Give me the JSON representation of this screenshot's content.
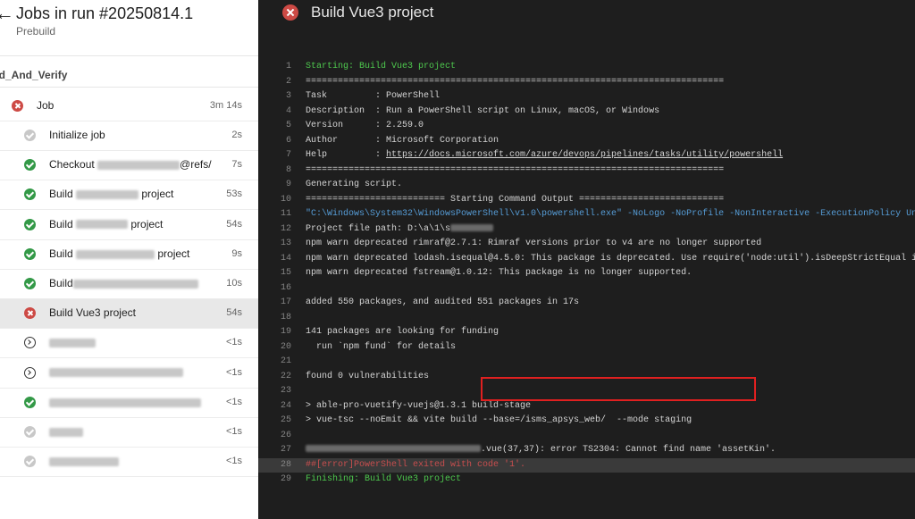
{
  "left": {
    "title": "Jobs in run #20250814.1",
    "subtitle": "Prebuild",
    "stage": "ild_And_Verify",
    "job": {
      "label": "Job",
      "duration": "3m 14s",
      "status": "fail"
    },
    "steps": [
      {
        "pre": "Initialize job",
        "post": "",
        "blur": 0,
        "duration": "2s",
        "status": "skip"
      },
      {
        "pre": "Checkout ",
        "post": "@refs/",
        "blur": 92,
        "duration": "7s",
        "status": "ok"
      },
      {
        "pre": "Build ",
        "post": " project",
        "blur": 70,
        "duration": "53s",
        "status": "ok"
      },
      {
        "pre": "Build ",
        "post": " project",
        "blur": 58,
        "duration": "54s",
        "status": "ok"
      },
      {
        "pre": "Build ",
        "post": " project",
        "blur": 88,
        "duration": "9s",
        "status": "ok"
      },
      {
        "pre": "Build",
        "post": "",
        "blur": 140,
        "duration": "10s",
        "status": "ok"
      },
      {
        "pre": "Build Vue3 project",
        "post": "",
        "blur": 0,
        "duration": "54s",
        "status": "fail",
        "selected": true
      },
      {
        "pre": "",
        "post": "",
        "blur": 52,
        "duration": "<1s",
        "status": "pend"
      },
      {
        "pre": "",
        "post": "",
        "blur": 150,
        "duration": "<1s",
        "status": "pend"
      },
      {
        "pre": "",
        "post": "",
        "blur": 170,
        "duration": "<1s",
        "status": "ok"
      },
      {
        "pre": "",
        "post": "",
        "blur": 38,
        "duration": "<1s",
        "status": "skip"
      },
      {
        "pre": "",
        "post": "",
        "blur": 78,
        "duration": "<1s",
        "status": "skip"
      }
    ]
  },
  "right": {
    "title": "Build Vue3 project",
    "lines": [
      {
        "n": "1",
        "segs": [
          {
            "t": "Starting: Build Vue3 project",
            "c": "green"
          }
        ]
      },
      {
        "n": "2",
        "segs": [
          {
            "t": "=============================================================================="
          }
        ]
      },
      {
        "n": "3",
        "segs": [
          {
            "t": "Task         : PowerShell"
          }
        ]
      },
      {
        "n": "4",
        "segs": [
          {
            "t": "Description  : Run a PowerShell script on Linux, macOS, or Windows"
          }
        ]
      },
      {
        "n": "5",
        "segs": [
          {
            "t": "Version      : 2.259.0"
          }
        ]
      },
      {
        "n": "6",
        "segs": [
          {
            "t": "Author       : Microsoft Corporation"
          }
        ]
      },
      {
        "n": "7",
        "segs": [
          {
            "t": "Help         : "
          },
          {
            "t": "https://docs.microsoft.com/azure/devops/pipelines/tasks/utility/powershell",
            "link": true
          }
        ]
      },
      {
        "n": "8",
        "segs": [
          {
            "t": "=============================================================================="
          }
        ]
      },
      {
        "n": "9",
        "segs": [
          {
            "t": "Generating script."
          }
        ]
      },
      {
        "n": "10",
        "segs": [
          {
            "t": "========================== Starting Command Output ==========================="
          }
        ]
      },
      {
        "n": "11",
        "segs": [
          {
            "t": "\"C:\\Windows\\System32\\WindowsPowerShell\\v1.0\\powershell.exe\" -NoLogo -NoProfile -NonInteractive -ExecutionPolicy Unrestricted",
            "c": "blue"
          }
        ]
      },
      {
        "n": "12",
        "segs": [
          {
            "t": "Project file path: D:\\a\\1\\s"
          },
          {
            "blur": 48
          }
        ]
      },
      {
        "n": "13",
        "segs": [
          {
            "t": "npm warn deprecated rimraf@2.7.1: Rimraf versions prior to v4 are no longer supported"
          }
        ]
      },
      {
        "n": "14",
        "segs": [
          {
            "t": "npm warn deprecated lodash.isequal@4.5.0: This package is deprecated. Use require('node:util').isDeepStrictEqual instead."
          }
        ]
      },
      {
        "n": "15",
        "segs": [
          {
            "t": "npm warn deprecated fstream@1.0.12: This package is no longer supported."
          }
        ]
      },
      {
        "n": "16",
        "segs": []
      },
      {
        "n": "17",
        "segs": [
          {
            "t": "added 550 packages, and audited 551 packages in 17s"
          }
        ]
      },
      {
        "n": "18",
        "segs": []
      },
      {
        "n": "19",
        "segs": [
          {
            "t": "141 packages are looking for funding"
          }
        ]
      },
      {
        "n": "20",
        "segs": [
          {
            "t": "  run `npm fund` for details"
          }
        ]
      },
      {
        "n": "21",
        "segs": []
      },
      {
        "n": "22",
        "segs": [
          {
            "t": "found 0 vulnerabilities"
          }
        ]
      },
      {
        "n": "23",
        "segs": []
      },
      {
        "n": "24",
        "segs": [
          {
            "t": "> able-pro-vuetify-vuejs@1.3.1 build-stage"
          }
        ]
      },
      {
        "n": "25",
        "segs": [
          {
            "t": "> vue-tsc --noEmit && vite build --base=/isms_apsys_web/  --mode staging"
          }
        ]
      },
      {
        "n": "26",
        "segs": []
      },
      {
        "n": "27",
        "segs": [
          {
            "blur": 196
          },
          {
            "t": ".vue(37,37): error TS2304: Cannot find name 'assetKin'."
          }
        ]
      },
      {
        "n": "28",
        "err": true,
        "segs": [
          {
            "t": "##[error]PowerShell exited with code '1'.",
            "c": "red"
          }
        ]
      },
      {
        "n": "29",
        "segs": [
          {
            "t": "Finishing: Build Vue3 project",
            "c": "green"
          }
        ]
      }
    ]
  }
}
